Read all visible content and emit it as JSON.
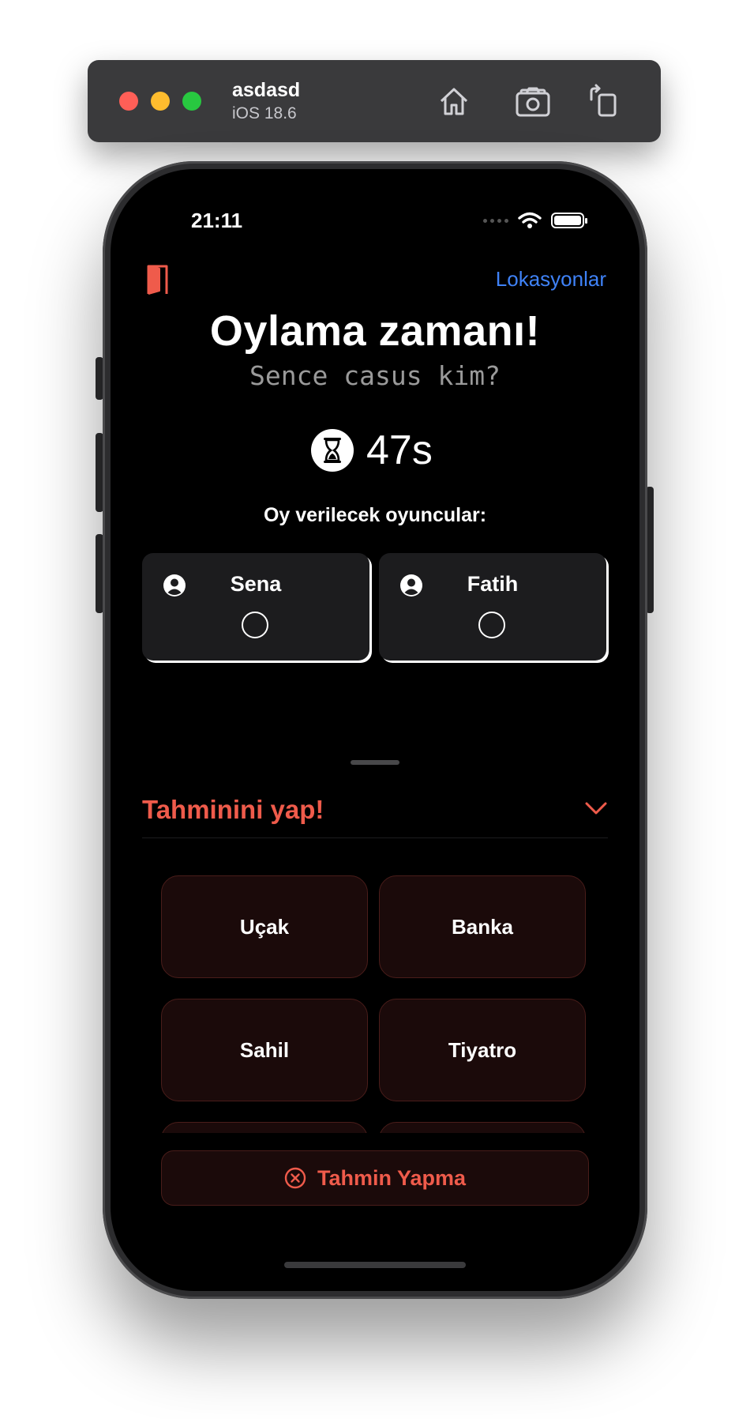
{
  "simulator": {
    "device_name": "asdasd",
    "os_version": "iOS 18.6",
    "toolbar_icons": [
      "home-icon",
      "screenshot-icon",
      "rotate-icon"
    ]
  },
  "status_bar": {
    "time": "21:11",
    "icons": [
      "cellular-icon",
      "wifi-icon",
      "battery-icon"
    ]
  },
  "header": {
    "exit_icon": "door-icon",
    "locations_link": "Lokasyonlar"
  },
  "main": {
    "title": "Oylama zamanı!",
    "subtitle": "Sence casus kim?",
    "timer": "47s",
    "players_label": "Oy verilecek oyuncular:",
    "players": [
      {
        "name": "Sena",
        "selected": false
      },
      {
        "name": "Fatih",
        "selected": false
      }
    ]
  },
  "guess_panel": {
    "title": "Tahminini yap!",
    "expanded": true,
    "locations": [
      "Uçak",
      "Banka",
      "Sahil",
      "Tiyatro",
      "",
      ""
    ],
    "no_guess_label": "Tahmin Yapma"
  },
  "colors": {
    "accent_red": "#ef5b4b",
    "link_blue": "#3f82f7",
    "background": "#000000",
    "card": "#1c1c1e",
    "location_button": "#1b0a0a"
  }
}
